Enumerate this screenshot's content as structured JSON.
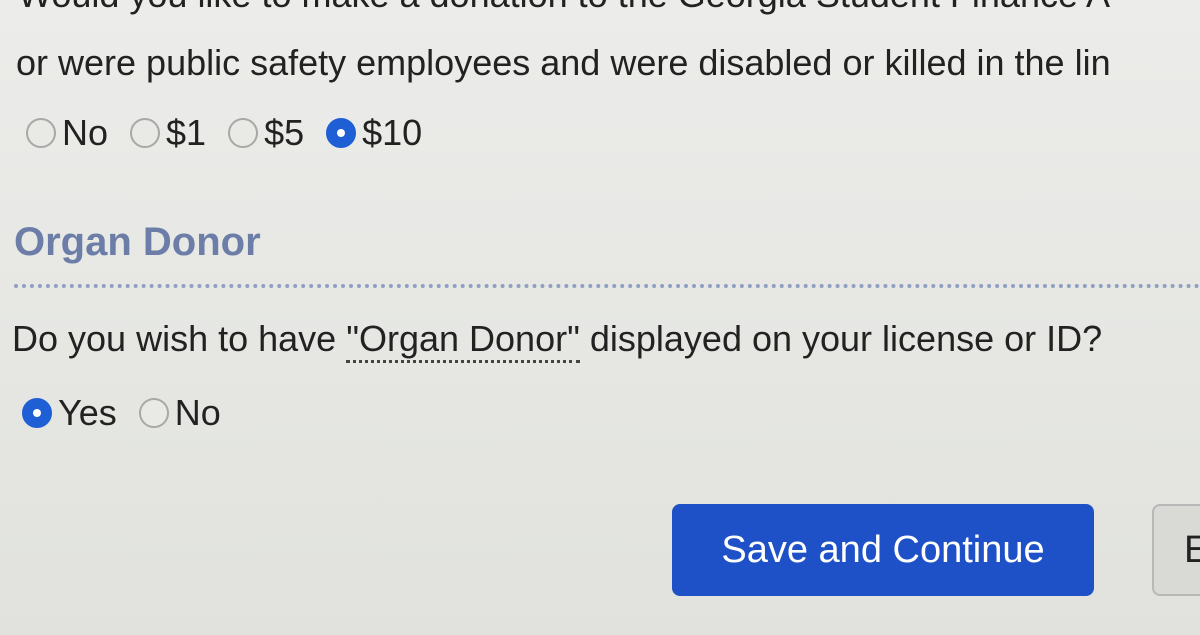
{
  "donation": {
    "question_line_1": "Would you like to make a donation to the Georgia Student Finance A",
    "question_line_2": "or were public safety employees and were disabled or killed in the lin",
    "options": [
      {
        "label": "No",
        "checked": false
      },
      {
        "label": "$1",
        "checked": false
      },
      {
        "label": "$5",
        "checked": false
      },
      {
        "label": "$10",
        "checked": true
      }
    ]
  },
  "organ_donor": {
    "section_title": "Organ Donor",
    "question_before": "Do you wish to have ",
    "question_term": "\"Organ Donor\"",
    "question_after": " displayed on your license or ID?",
    "options": [
      {
        "label": "Yes",
        "checked": true
      },
      {
        "label": "No",
        "checked": false
      }
    ]
  },
  "actions": {
    "save_continue_label": "Save and Continue",
    "secondary_label": "E"
  },
  "colors": {
    "accent_blue": "#1e50c7",
    "section_title": "#6c7ea8",
    "divider": "#8f9fc2"
  }
}
